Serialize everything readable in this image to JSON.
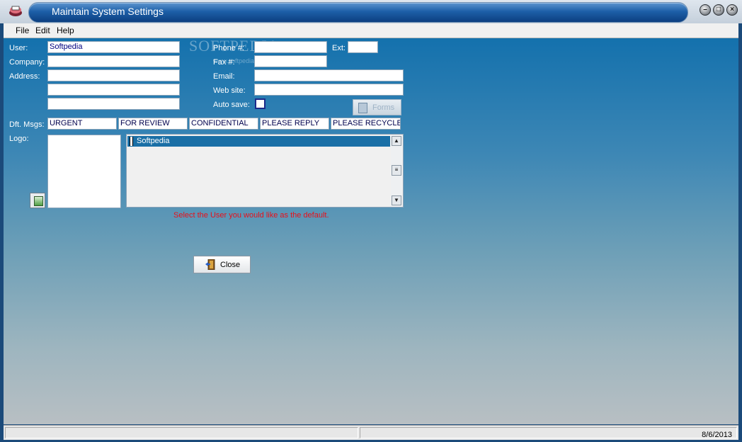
{
  "window": {
    "title": "Maintain System Settings"
  },
  "menu": {
    "items": [
      "File",
      "Edit",
      "Help"
    ]
  },
  "watermark": {
    "main": "SOFTPEDIA",
    "sub": "www.softpedia.com"
  },
  "form": {
    "user_label": "User:",
    "user_value": "Softpedia",
    "company_label": "Company:",
    "company_value": "",
    "address_label": "Address:",
    "address_lines": [
      "",
      "",
      ""
    ],
    "phone_label": "Phone #:",
    "phone_value": "",
    "ext_label": "Ext:",
    "ext_value": "",
    "fax_label": "Fax #:",
    "fax_value": "",
    "email_label": "Email:",
    "email_value": "",
    "website_label": "Web site:",
    "website_value": "",
    "autosave_label": "Auto save:",
    "autosave_checked": false,
    "forms_button": "Forms",
    "msgs_label": "Dft. Msgs:",
    "msgs": [
      "URGENT",
      "FOR REVIEW",
      "CONFIDENTIAL",
      "PLEASE REPLY",
      "PLEASE RECYCLE"
    ],
    "logo_label": "Logo:"
  },
  "user_list": {
    "items": [
      "Softpedia"
    ],
    "selected": "Softpedia"
  },
  "hint": "Select the User you would like as the default.",
  "close_button": "Close",
  "status": {
    "date": "8/6/2013"
  }
}
